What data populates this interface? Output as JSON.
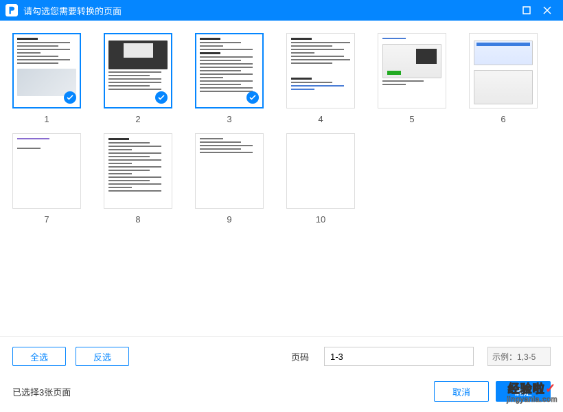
{
  "titlebar": {
    "title": "请勾选您需要转换的页面"
  },
  "pages": [
    {
      "num": "1",
      "selected": true,
      "style": "doc-photo"
    },
    {
      "num": "2",
      "selected": true,
      "style": "photo-text"
    },
    {
      "num": "3",
      "selected": true,
      "style": "text-dense"
    },
    {
      "num": "4",
      "selected": false,
      "style": "text-sparse"
    },
    {
      "num": "5",
      "selected": false,
      "style": "screenshot-a"
    },
    {
      "num": "6",
      "selected": false,
      "style": "screenshot-b"
    },
    {
      "num": "7",
      "selected": false,
      "style": "minimal"
    },
    {
      "num": "8",
      "selected": false,
      "style": "text-list"
    },
    {
      "num": "9",
      "selected": false,
      "style": "text-top"
    },
    {
      "num": "10",
      "selected": false,
      "style": "blank"
    }
  ],
  "footer": {
    "select_all": "全选",
    "invert": "反选",
    "page_label": "页码",
    "page_value": "1-3",
    "example": "示例：1,3-5",
    "status": "已选择3张页面",
    "cancel": "取消",
    "confirm": "确定"
  },
  "watermark": {
    "top": "经验啦",
    "bottom": "jingyanla.com"
  }
}
